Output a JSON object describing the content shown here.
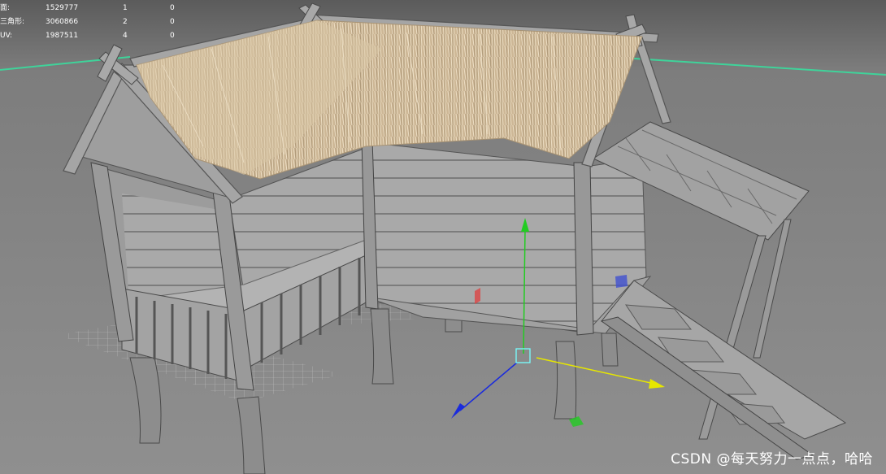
{
  "hud": {
    "rows": [
      {
        "label": "面:",
        "v1": "1529777",
        "v2": "1",
        "v3": "0"
      },
      {
        "label": "三角形:",
        "v1": "3060866",
        "v2": "2",
        "v3": "0"
      },
      {
        "label": "UV:",
        "v1": "1987511",
        "v2": "4",
        "v3": "0"
      }
    ]
  },
  "watermark": "CSDN @每天努力一点点，哈哈",
  "colors": {
    "background": "#8a8a8a",
    "horizon_line": "#3fd39a",
    "thatch": "#d6c1a0",
    "wood": "#a7a7a7",
    "axis_y": "#22cc22",
    "axis_x": "#e6e600",
    "axis_z": "#1a2bdd"
  },
  "icons": [
    "move-gizmo-icon",
    "pivot-square-icon",
    "plane-handle-icon"
  ]
}
